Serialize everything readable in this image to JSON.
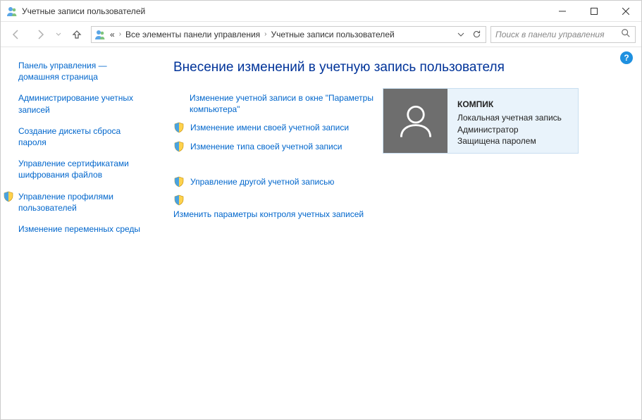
{
  "window": {
    "title": "Учетные записи пользователей"
  },
  "addressbar": {
    "ellipsis": "«",
    "crumbs": [
      "Все элементы панели управления",
      "Учетные записи пользователей"
    ]
  },
  "search": {
    "placeholder": "Поиск в панели управления"
  },
  "sidebar": {
    "items": [
      {
        "label": "Панель управления — домашняя страница",
        "shield": false
      },
      {
        "label": "Администрирование учетных записей",
        "shield": false
      },
      {
        "label": "Создание дискеты сброса пароля",
        "shield": false
      },
      {
        "label": "Управление сертификатами шифрования файлов",
        "shield": false
      },
      {
        "label": "Управление профилями пользователей",
        "shield": true
      },
      {
        "label": "Изменение переменных среды",
        "shield": false
      }
    ]
  },
  "main": {
    "heading": "Внесение изменений в учетную запись пользователя",
    "actions": [
      {
        "label": "Изменение учетной записи в окне \"Параметры компьютера\"",
        "shield": false
      },
      {
        "label": "Изменение имени своей учетной записи",
        "shield": true
      },
      {
        "label": "Изменение типа своей учетной записи",
        "shield": true
      }
    ],
    "actions2": [
      {
        "label": "Управление другой учетной записью",
        "shield": true
      },
      {
        "label": "Изменить параметры контроля учетных записей",
        "shield": true,
        "below": true
      }
    ]
  },
  "user": {
    "name": "КОМПИК",
    "type": "Локальная учетная запись",
    "role": "Администратор",
    "protect": "Защищена паролем"
  }
}
